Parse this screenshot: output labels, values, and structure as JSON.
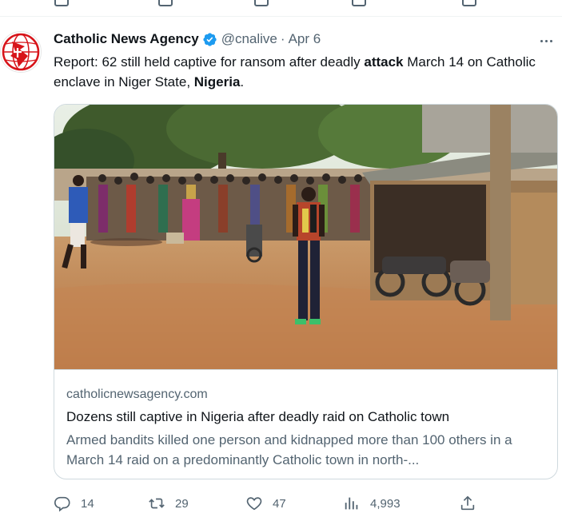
{
  "tweet": {
    "author_name": "Catholic News Agency",
    "handle": "@cnalive",
    "separator": "·",
    "date": "Apr 6",
    "text_parts": [
      {
        "text": "Report: 62 still held captive for ransom after deadly ",
        "bold": false
      },
      {
        "text": "attack",
        "bold": true
      },
      {
        "text": " March 14 on Catholic enclave in Niger State, ",
        "bold": false
      },
      {
        "text": "Nigeria",
        "bold": true
      },
      {
        "text": ".",
        "bold": false
      }
    ]
  },
  "card": {
    "domain": "catholicnewsagency.com",
    "title": "Dozens still captive in Nigeria after deadly raid on Catholic town",
    "description": "Armed bandits killed one person and kidnapped more than 100 others in a March 14 raid on a predominantly Catholic town in north-..."
  },
  "actions": {
    "replies": "14",
    "retweets": "29",
    "likes": "47",
    "views": "4,993"
  },
  "colors": {
    "verified": "#1d9bf0",
    "secondary_text": "#536471",
    "avatar_red": "#d7141a"
  },
  "icons": [
    "cna-logo-icon",
    "verified-badge-icon",
    "more-icon",
    "reply-icon",
    "retweet-icon",
    "like-icon",
    "views-icon",
    "share-icon"
  ]
}
